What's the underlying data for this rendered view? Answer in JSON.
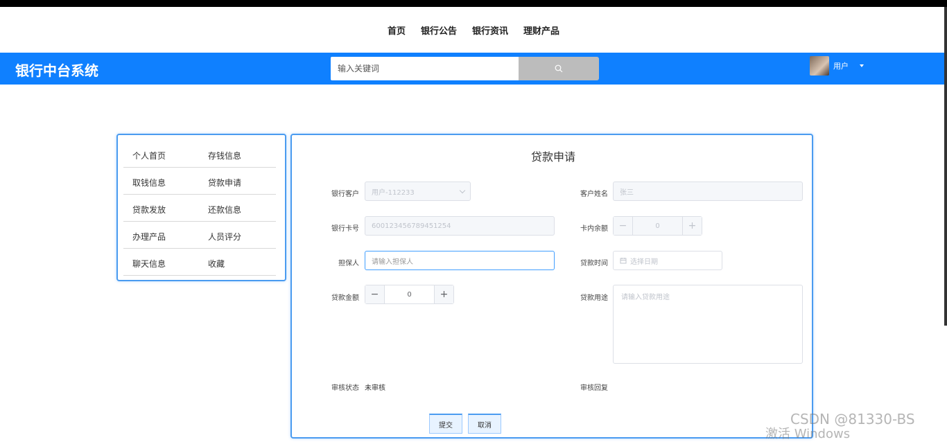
{
  "topnav": {
    "items": [
      "首页",
      "银行公告",
      "银行资讯",
      "理财产品"
    ]
  },
  "header": {
    "brand": "银行中台系统",
    "search_placeholder": "输入关键词",
    "user_label": "用户"
  },
  "sidemenu": {
    "rows": [
      [
        "个人首页",
        "存钱信息"
      ],
      [
        "取钱信息",
        "贷款申请"
      ],
      [
        "贷款发放",
        "还款信息"
      ],
      [
        "办理产品",
        "人员评分"
      ],
      [
        "聊天信息",
        "收藏"
      ]
    ]
  },
  "form": {
    "title": "贷款申请",
    "bank_customer_label": "银行客户",
    "bank_customer_value": "用户-112233",
    "customer_name_label": "客户姓名",
    "customer_name_value": "张三",
    "bank_card_label": "银行卡号",
    "bank_card_value": "600123456789451254",
    "card_balance_label": "卡内余额",
    "card_balance_value": "0",
    "guarantor_label": "担保人",
    "guarantor_placeholder": "请输入担保人",
    "loan_time_label": "贷款时间",
    "loan_time_placeholder": "选择日期",
    "loan_amount_label": "贷款金额",
    "loan_amount_value": "0",
    "loan_purpose_label": "贷款用途",
    "loan_purpose_placeholder": "请输入贷款用途",
    "review_status_label": "审核状态",
    "review_status_value": "未审核",
    "review_reply_label": "审核回复",
    "submit_label": "提交",
    "cancel_label": "取消"
  },
  "watermark": {
    "csdn": "CSDN @81330-BS",
    "windows": "激活 Windows"
  }
}
